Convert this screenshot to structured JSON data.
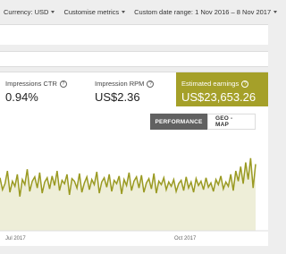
{
  "topbar": {
    "currency": "Currency: USD",
    "metrics": "Customise metrics",
    "date_range": "Custom date range: 1 Nov 2016 – 8 Nov 2017"
  },
  "metrics": [
    {
      "label": "Impressions CTR",
      "value": "0.94%"
    },
    {
      "label": "Impression RPM",
      "value": "US$2.36"
    },
    {
      "label": "Estimated earnings",
      "value": "US$23,653.26"
    }
  ],
  "tabs": {
    "performance": "PERFORMANCE",
    "geo_map": "GEO - MAP"
  },
  "colors": {
    "accent": "#a5a029",
    "line": "#9a9a22",
    "fill": "#eeeed8"
  },
  "chart_data": {
    "type": "area",
    "x_tick_labels": [
      "Jul 2017",
      "Oct 2017"
    ],
    "series": [
      {
        "values": [
          62,
          48,
          55,
          70,
          45,
          58,
          52,
          66,
          40,
          60,
          54,
          72,
          46,
          58,
          63,
          50,
          68,
          44,
          57,
          62,
          49,
          64,
          53,
          70,
          47,
          59,
          55,
          66,
          42,
          61,
          58,
          50,
          67,
          45,
          56,
          63,
          48,
          60,
          54,
          69,
          44,
          57,
          62,
          51,
          66,
          46,
          59,
          55,
          64,
          43,
          60,
          53,
          68,
          47,
          58,
          63,
          50,
          65,
          45,
          56,
          61,
          49,
          67,
          44,
          58,
          54,
          62,
          48,
          57,
          52,
          60,
          46,
          55,
          59,
          47,
          63,
          50,
          57,
          45,
          61,
          53,
          58,
          48,
          62,
          51,
          56,
          46,
          60,
          54,
          64,
          49,
          57,
          52,
          66,
          47,
          70,
          58,
          75,
          55,
          80,
          60,
          85,
          50,
          78
        ]
      }
    ]
  }
}
